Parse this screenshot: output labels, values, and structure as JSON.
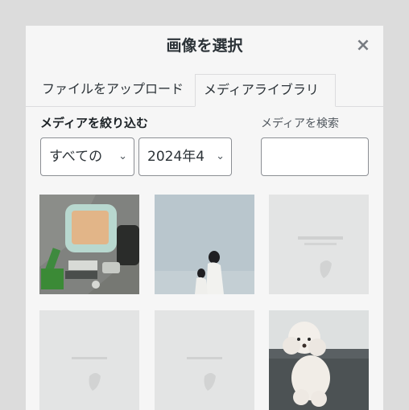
{
  "modal": {
    "title": "画像を選択",
    "close": "×"
  },
  "tabs": [
    {
      "label": "ファイルをアップロード",
      "active": false
    },
    {
      "label": "メディアライブラリ",
      "active": true
    }
  ],
  "filters": {
    "label": "メディアを絞り込む",
    "type_value": "すべての",
    "date_value": "2024年4",
    "search_label": "メディアを検索",
    "search_value": ""
  },
  "thumbnails": [
    {
      "name": "photo-desk-items"
    },
    {
      "name": "photo-mother-child"
    },
    {
      "name": "photo-card-1"
    },
    {
      "name": "photo-card-2"
    },
    {
      "name": "photo-card-3"
    },
    {
      "name": "photo-poodle"
    }
  ]
}
